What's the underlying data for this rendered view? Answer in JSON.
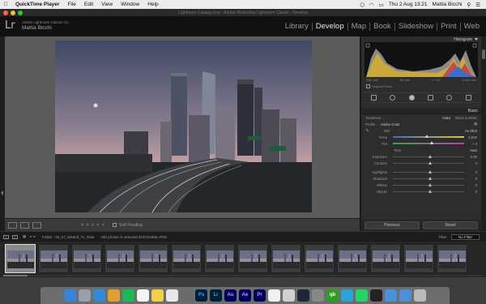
{
  "menubar": {
    "app_name": "QuickTime Player",
    "items": [
      "File",
      "Edit",
      "View",
      "Window",
      "Help"
    ],
    "date_time": "Thu 2 Aug  13:21",
    "user": "Mattia Bicchi"
  },
  "window": {
    "title": "Lightroom Catalog.lrcat - Adobe Photoshop Lightroom Classic - Develop"
  },
  "identity": {
    "logo": "Lr",
    "product": "Adobe Lightroom Classic CC",
    "user_name": "Mattia Bicchi"
  },
  "modules": [
    "Library",
    "Develop",
    "Map",
    "Book",
    "Slideshow",
    "Print",
    "Web"
  ],
  "toolbar": {
    "stars": "★★★★★",
    "soft_proofing": "Soft Proofing"
  },
  "right_panel": {
    "histogram_title": "Histogram",
    "histo_info": [
      "ISO 100",
      "50 mm",
      "f / 3.5",
      "1/100 sec"
    ],
    "original_photo": "Original Photo",
    "basic_title": "Basic",
    "treatment_label": "Treatment :",
    "treatment_color": "Color",
    "treatment_bw": "Black & White",
    "profile_label": "Profile :",
    "profile_value": "Adobe Color",
    "wb_label": "WB :",
    "wb_value": "As Shot",
    "temp_label": "Temp",
    "temp_value": "5,500",
    "tint_label": "Tint",
    "tint_value": "+ 4",
    "tone_label": "Tone",
    "auto_label": "Auto",
    "exposure_label": "Exposure",
    "exposure_value": "0.00",
    "contrast_label": "Contrast",
    "contrast_value": "0",
    "highlights_label": "Highlights",
    "highlights_value": "0",
    "shadows_label": "Shadows",
    "shadows_value": "0",
    "whites_label": "Whites",
    "whites_value": "0",
    "blacks_label": "Blacks",
    "blacks_value": "0",
    "previous_btn": "Previous",
    "reset_btn": "Reset"
  },
  "filmbar": {
    "page1": "1",
    "page2": "2",
    "crumb": "Folder : 26_07_Madrid_TL_Raw",
    "count": "400 photos /1 selected /DSC01555.ARW",
    "filter_label": "Filter :",
    "filter_value": "No Filter"
  },
  "colors": {
    "accent_active": "#e6e6e6",
    "panel_bg": "#2d2d2d",
    "canvas_bg": "#5b5b5b"
  },
  "dock": {
    "icons": [
      "finder-icon",
      "launchpad-icon",
      "safari-icon",
      "chrome-icon",
      "spotify-icon",
      "calendar-icon",
      "notes-icon",
      "photos-icon",
      "camera-icon",
      "photoshop-icon",
      "lightroom-icon",
      "audition-icon",
      "aftereffects-icon",
      "premiere-icon",
      "mail-icon",
      "disk-icon",
      "steam-icon",
      "settings-icon",
      "quickbooks-icon",
      "telegram-icon",
      "whatsapp-icon",
      "terminal-icon",
      "folder-icon",
      "downloads-icon",
      "trash-icon"
    ],
    "labels": {
      "photoshop": "Ps",
      "lightroom": "Lr",
      "aftereffects": "Ae",
      "premiere": "Pr",
      "audition": "Au"
    }
  }
}
